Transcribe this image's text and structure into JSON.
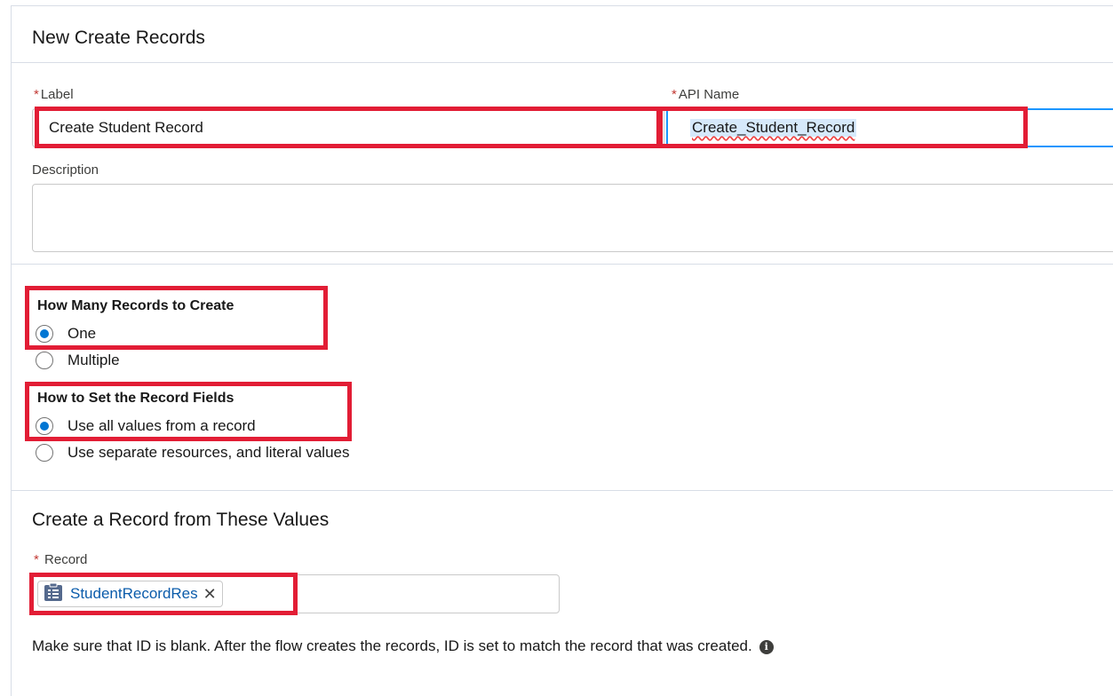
{
  "header": {
    "title": "New Create Records"
  },
  "fields": {
    "label": {
      "required_mark": "*",
      "label": "Label",
      "value": "Create Student Record"
    },
    "api_name": {
      "required_mark": "*",
      "label": "API Name",
      "value": "Create_Student_Record"
    },
    "description": {
      "label": "Description",
      "value": ""
    }
  },
  "how_many": {
    "title": "How Many Records to Create",
    "options": [
      {
        "label": "One",
        "checked": true
      },
      {
        "label": "Multiple",
        "checked": false
      }
    ]
  },
  "how_to_set": {
    "title": "How to Set the Record Fields",
    "options": [
      {
        "label": "Use all values from a record",
        "checked": true
      },
      {
        "label": "Use separate resources, and literal values",
        "checked": false
      }
    ]
  },
  "record_section": {
    "title": "Create a Record from These Values",
    "record_field": {
      "required_mark": "*",
      "label": "Record",
      "pill_label": "StudentRecordRes",
      "pill_icon": "record-icon",
      "remove_icon": "close-icon"
    },
    "helper_text": "Make sure that ID is blank. After the flow creates the records, ID is set to match the record that was created.",
    "info_icon": "info-icon"
  },
  "colors": {
    "highlight_box": "#e21d35",
    "radio_selected": "#0176d3",
    "pill_text": "#0b5cab",
    "focus_border": "#1b96ff"
  }
}
